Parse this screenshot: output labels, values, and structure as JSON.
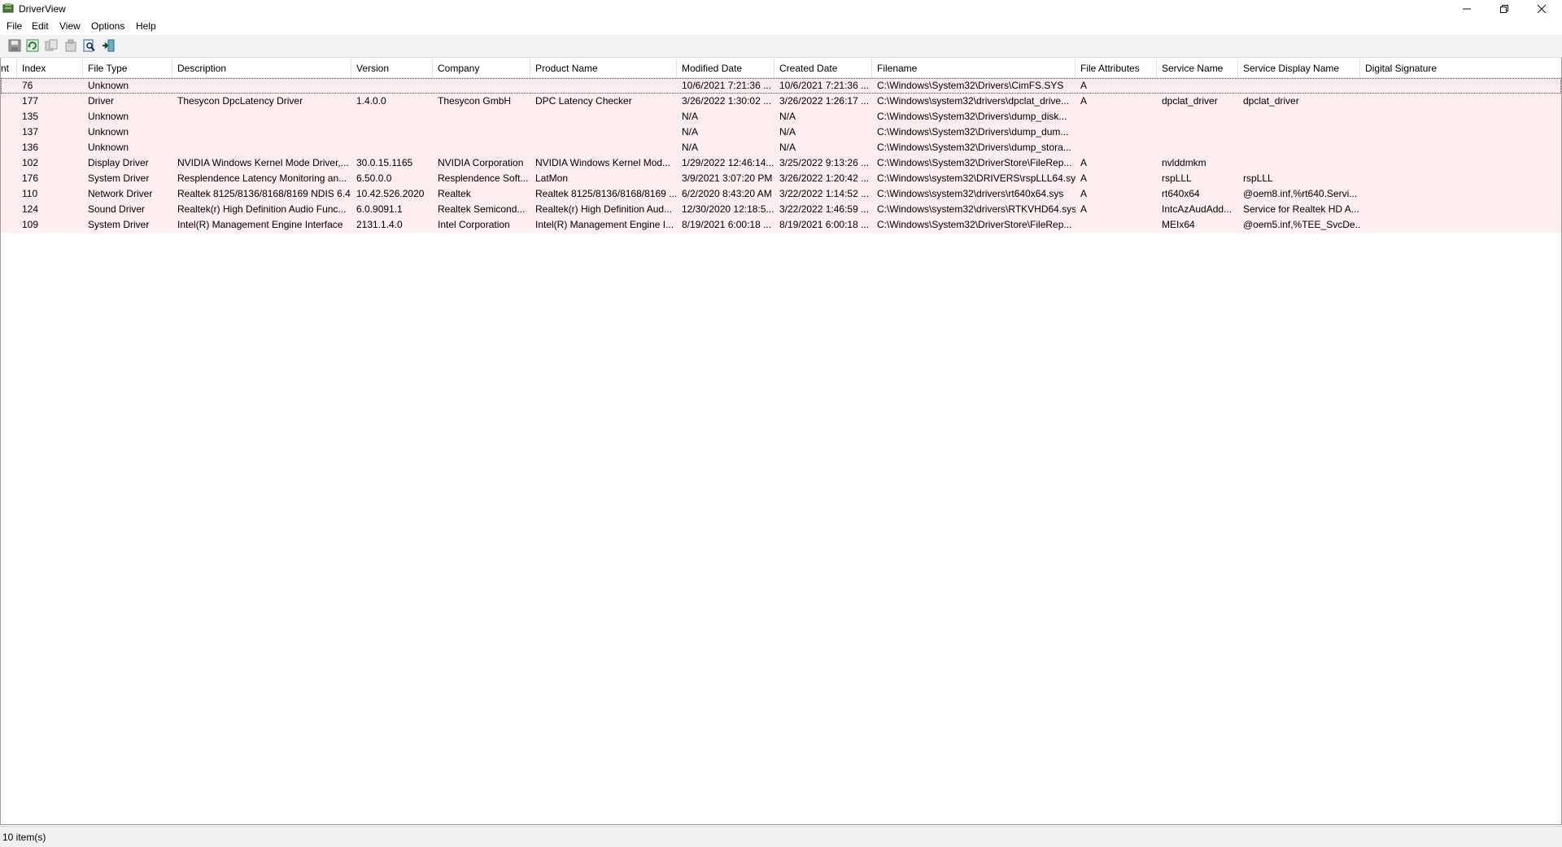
{
  "window": {
    "title": "DriverView",
    "controls": [
      "minimize-icon",
      "restore-icon",
      "close-icon"
    ]
  },
  "menu": [
    "File",
    "Edit",
    "View",
    "Options",
    "Help"
  ],
  "toolbar": {
    "buttons": [
      "save-icon",
      "refresh-icon",
      "copy-icon",
      "properties-icon",
      "find-icon",
      "exit-icon"
    ]
  },
  "columns": [
    "nt",
    "Index",
    "File Type",
    "Description",
    "Version",
    "Company",
    "Product Name",
    "Modified Date",
    "Created Date",
    "Filename",
    "File Attributes",
    "Service Name",
    "Service Display Name",
    "Digital Signature"
  ],
  "rows": [
    [
      "",
      "76",
      "Unknown",
      "",
      "",
      "",
      "",
      "10/6/2021 7:21:36 ...",
      "10/6/2021 7:21:36 ...",
      "C:\\Windows\\System32\\Drivers\\CimFS.SYS",
      "A",
      "",
      "",
      ""
    ],
    [
      "",
      "177",
      "Driver",
      "Thesycon DpcLatency Driver",
      "1.4.0.0",
      "Thesycon GmbH",
      "DPC Latency Checker",
      "3/26/2022 1:30:02 ...",
      "3/26/2022 1:26:17 ...",
      "C:\\Windows\\system32\\drivers\\dpclat_drive...",
      "A",
      "dpclat_driver",
      "dpclat_driver",
      ""
    ],
    [
      "",
      "135",
      "Unknown",
      "",
      "",
      "",
      "",
      "N/A",
      "N/A",
      "C:\\Windows\\System32\\Drivers\\dump_disk...",
      "",
      "",
      "",
      ""
    ],
    [
      "",
      "137",
      "Unknown",
      "",
      "",
      "",
      "",
      "N/A",
      "N/A",
      "C:\\Windows\\System32\\Drivers\\dump_dum...",
      "",
      "",
      "",
      ""
    ],
    [
      "",
      "136",
      "Unknown",
      "",
      "",
      "",
      "",
      "N/A",
      "N/A",
      "C:\\Windows\\System32\\Drivers\\dump_stora...",
      "",
      "",
      "",
      ""
    ],
    [
      "",
      "102",
      "Display Driver",
      "NVIDIA Windows Kernel Mode Driver,...",
      "30.0.15.1165",
      "NVIDIA Corporation",
      "NVIDIA Windows Kernel Mod...",
      "1/29/2022 12:46:14...",
      "3/25/2022 9:13:26 ...",
      "C:\\Windows\\System32\\DriverStore\\FileRep...",
      "A",
      "nvlddmkm",
      "",
      ""
    ],
    [
      "",
      "176",
      "System Driver",
      "Resplendence Latency Monitoring an...",
      "6.50.0.0",
      "Resplendence Soft...",
      "LatMon",
      "3/9/2021 3:07:20 PM",
      "3/26/2022 1:20:42 ...",
      "C:\\Windows\\system32\\DRIVERS\\rspLLL64.sys",
      "A",
      "rspLLL",
      "rspLLL",
      ""
    ],
    [
      "",
      "110",
      "Network Driver",
      "Realtek 8125/8136/8168/8169 NDIS 6.4...",
      "10.42.526.2020",
      "Realtek",
      "Realtek 8125/8136/8168/8169 ...",
      "6/2/2020 8:43:20 AM",
      "3/22/2022 1:14:52 ...",
      "C:\\Windows\\system32\\drivers\\rt640x64.sys",
      "A",
      "rt640x64",
      "@oem8.inf,%rt640.Servi...",
      ""
    ],
    [
      "",
      "124",
      "Sound Driver",
      "Realtek(r) High Definition Audio Func...",
      "6.0.9091.1",
      "Realtek Semicond...",
      "Realtek(r) High Definition Aud...",
      "12/30/2020 12:18:5...",
      "3/22/2022 1:46:59 ...",
      "C:\\Windows\\system32\\drivers\\RTKVHD64.sys",
      "A",
      "IntcAzAudAdd...",
      "Service for Realtek HD A...",
      ""
    ],
    [
      "",
      "109",
      "System Driver",
      "Intel(R) Management Engine Interface",
      "2131.1.4.0",
      "Intel Corporation",
      "Intel(R) Management Engine I...",
      "8/19/2021 6:00:18 ...",
      "8/19/2021 6:00:18 ...",
      "C:\\Windows\\System32\\DriverStore\\FileRep...",
      "",
      "MEIx64",
      "@oem5.inf,%TEE_SvcDe...",
      ""
    ]
  ],
  "status": {
    "text": "10 item(s)"
  },
  "colors": {
    "row_background": "#ffeeee",
    "toolbar_background": "#f3f3f3",
    "status_background": "#f0f0f0"
  }
}
